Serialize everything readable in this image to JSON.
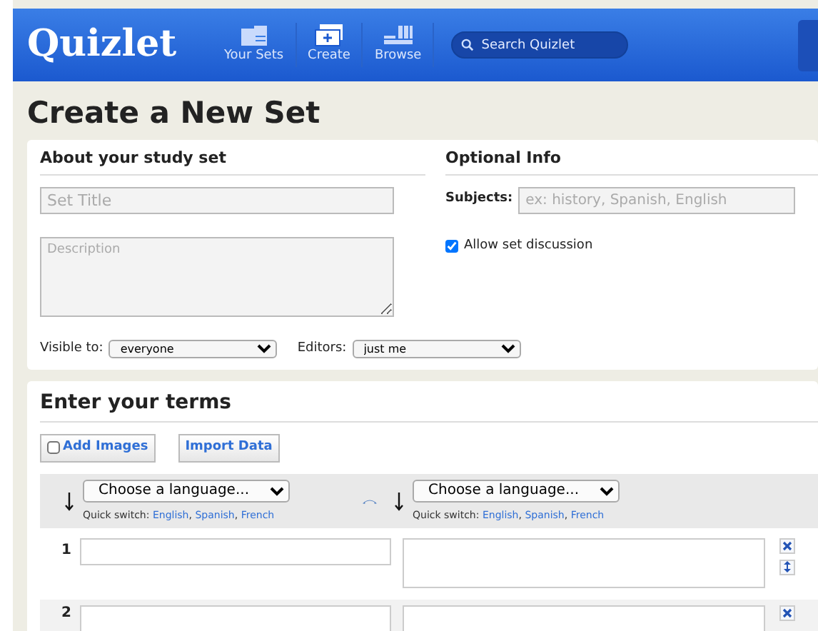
{
  "header": {
    "logo": "Quizlet",
    "nav": [
      {
        "label": "Your Sets",
        "kind": "folder"
      },
      {
        "label": "Create",
        "kind": "create"
      },
      {
        "label": "Browse",
        "kind": "browse"
      }
    ],
    "search": {
      "placeholder": "Search Quizlet"
    }
  },
  "page_title": "Create a New Set",
  "about": {
    "heading": "About your study set",
    "title": {
      "placeholder": "Set Title"
    },
    "description": {
      "placeholder": "Description"
    },
    "visible_label": "Visible to:",
    "visible_value": "everyone",
    "editors_label": "Editors:",
    "editors_value": "just me"
  },
  "optional": {
    "heading": "Optional Info",
    "subjects_label": "Subjects:",
    "subjects": {
      "placeholder": "ex: history, Spanish, English"
    },
    "discussion": {
      "label": "Allow set discussion",
      "checked": true
    }
  },
  "terms": {
    "heading": "Enter your terms",
    "add_images": {
      "label": "Add Images",
      "checked": false
    },
    "import_label": "Import Data",
    "languages": [
      {
        "value": "Choose a language...",
        "quick_label": "Quick switch:",
        "quick": [
          {
            "label": "English",
            "sep": ","
          },
          {
            "label": "Spanish",
            "sep": ","
          },
          {
            "label": "French"
          }
        ]
      },
      {
        "value": "Choose a language...",
        "quick_label": "Quick switch:",
        "quick": [
          {
            "label": "English",
            "sep": ","
          },
          {
            "label": "Spanish",
            "sep": ","
          },
          {
            "label": "French"
          }
        ]
      }
    ],
    "rows": [
      {
        "number": "1"
      },
      {
        "number": "2"
      }
    ]
  }
}
